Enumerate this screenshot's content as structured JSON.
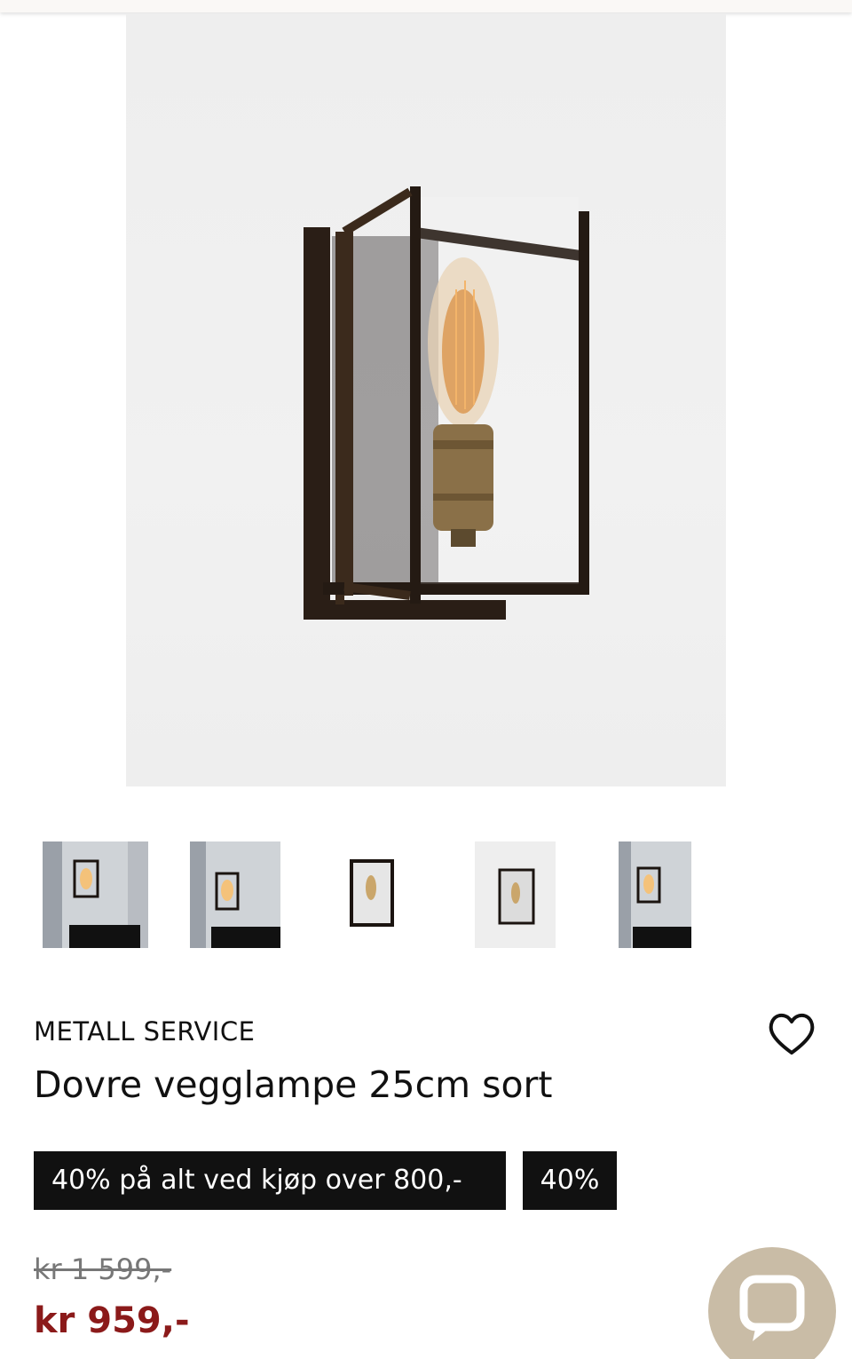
{
  "product": {
    "brand": "METALL SERVICE",
    "title": "Dovre vegglampe 25cm sort",
    "promo_badge": "40% på alt ved kjøp over 800,-",
    "discount_badge": "40%",
    "old_price": "kr 1 599,-",
    "new_price": "kr 959,-"
  },
  "gallery": {
    "thumbnails": [
      "lamp-room-photo",
      "lamp-room-photo",
      "lamp-product-photo",
      "lamp-product-photo",
      "lamp-room-photo"
    ]
  },
  "icons": {
    "favorite": "heart-icon",
    "chat": "chat-bubble-icon"
  },
  "colors": {
    "sale_price": "#8b1a1a",
    "badge_bg": "#111111",
    "chat_button": "#c9bca6"
  }
}
